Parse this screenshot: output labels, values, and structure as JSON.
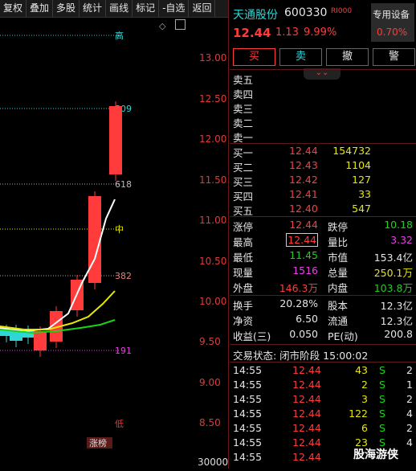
{
  "toolbar": [
    "复权",
    "叠加",
    "多股",
    "统计",
    "画线",
    "标记",
    "-自选",
    "返回"
  ],
  "chart": {
    "y_ticks": [
      "13.00",
      "12.50",
      "12.00",
      "11.50",
      "11.00",
      "10.50",
      "10.00",
      "9.50",
      "9.00",
      "8.50"
    ],
    "bottom_tick": "30000",
    "markers": {
      "top": "高",
      "p809": "809",
      "p618": "618",
      "mid": "中",
      "p382": "382",
      "p191": "191",
      "low": "低",
      "limit": "涨榜"
    }
  },
  "stock": {
    "name": "天通股份",
    "code": "600330",
    "tag": "RI000",
    "price": "12.44",
    "change": "1.13",
    "pct": "9.99%",
    "device_label": "专用设备",
    "device_pct": "0.70%"
  },
  "actions": [
    "买",
    "卖",
    "撤",
    "警"
  ],
  "expand_icon": "chevron-down-double-icon",
  "sell_levels": [
    {
      "label": "卖五"
    },
    {
      "label": "卖四"
    },
    {
      "label": "卖三"
    },
    {
      "label": "卖二"
    },
    {
      "label": "卖一"
    }
  ],
  "buy_levels": [
    {
      "label": "买一",
      "price": "12.44",
      "vol": "154732"
    },
    {
      "label": "买二",
      "price": "12.43",
      "vol": "1104"
    },
    {
      "label": "买三",
      "price": "12.42",
      "vol": "127"
    },
    {
      "label": "买四",
      "price": "12.41",
      "vol": "33"
    },
    {
      "label": "买五",
      "price": "12.40",
      "vol": "547"
    }
  ],
  "quote": [
    {
      "l1": "涨停",
      "v1": "12.44",
      "l2": "跌停",
      "v2": "10.18"
    },
    {
      "l1": "最高",
      "v1": "12.44",
      "l2": "量比",
      "v2": "3.32"
    },
    {
      "l1": "最低",
      "v1": "11.45",
      "l2": "市值",
      "v2": "153.4亿"
    },
    {
      "l1": "现量",
      "v1": "1516",
      "l2": "总量",
      "v2": "250.1万"
    },
    {
      "l1": "外盘",
      "v1": "146.3万",
      "l2": "内盘",
      "v2": "103.8万"
    }
  ],
  "fund": [
    {
      "l1": "换手",
      "v1": "20.28%",
      "l2": "股本",
      "v2": "12.3亿"
    },
    {
      "l1": "净资",
      "v1": "6.50",
      "l2": "流通",
      "v2": "12.3亿"
    },
    {
      "l1": "收益(三)",
      "v1": "0.050",
      "l2": "PE(动)",
      "v2": "200.8"
    }
  ],
  "status": "交易状态: 闭市阶段 15:00:02",
  "ticks": [
    {
      "t": "14:55",
      "p": "12.44",
      "v": "43",
      "s": "S",
      "n": "2"
    },
    {
      "t": "14:55",
      "p": "12.44",
      "v": "2",
      "s": "S",
      "n": "1"
    },
    {
      "t": "14:55",
      "p": "12.44",
      "v": "3",
      "s": "S",
      "n": "2"
    },
    {
      "t": "14:55",
      "p": "12.44",
      "v": "122",
      "s": "S",
      "n": "4"
    },
    {
      "t": "14:55",
      "p": "12.44",
      "v": "6",
      "s": "S",
      "n": "2"
    },
    {
      "t": "14:55",
      "p": "12.44",
      "v": "23",
      "s": "S",
      "n": "4"
    },
    {
      "t": "14:55",
      "p": "12.44",
      "v": "",
      "s": "",
      "n": ""
    }
  ],
  "watermark": "股海游侠",
  "colors": {
    "up": "#ff3b3b",
    "down": "#19d419",
    "volume": "#e8e800",
    "accent": "#2fd6d6"
  }
}
